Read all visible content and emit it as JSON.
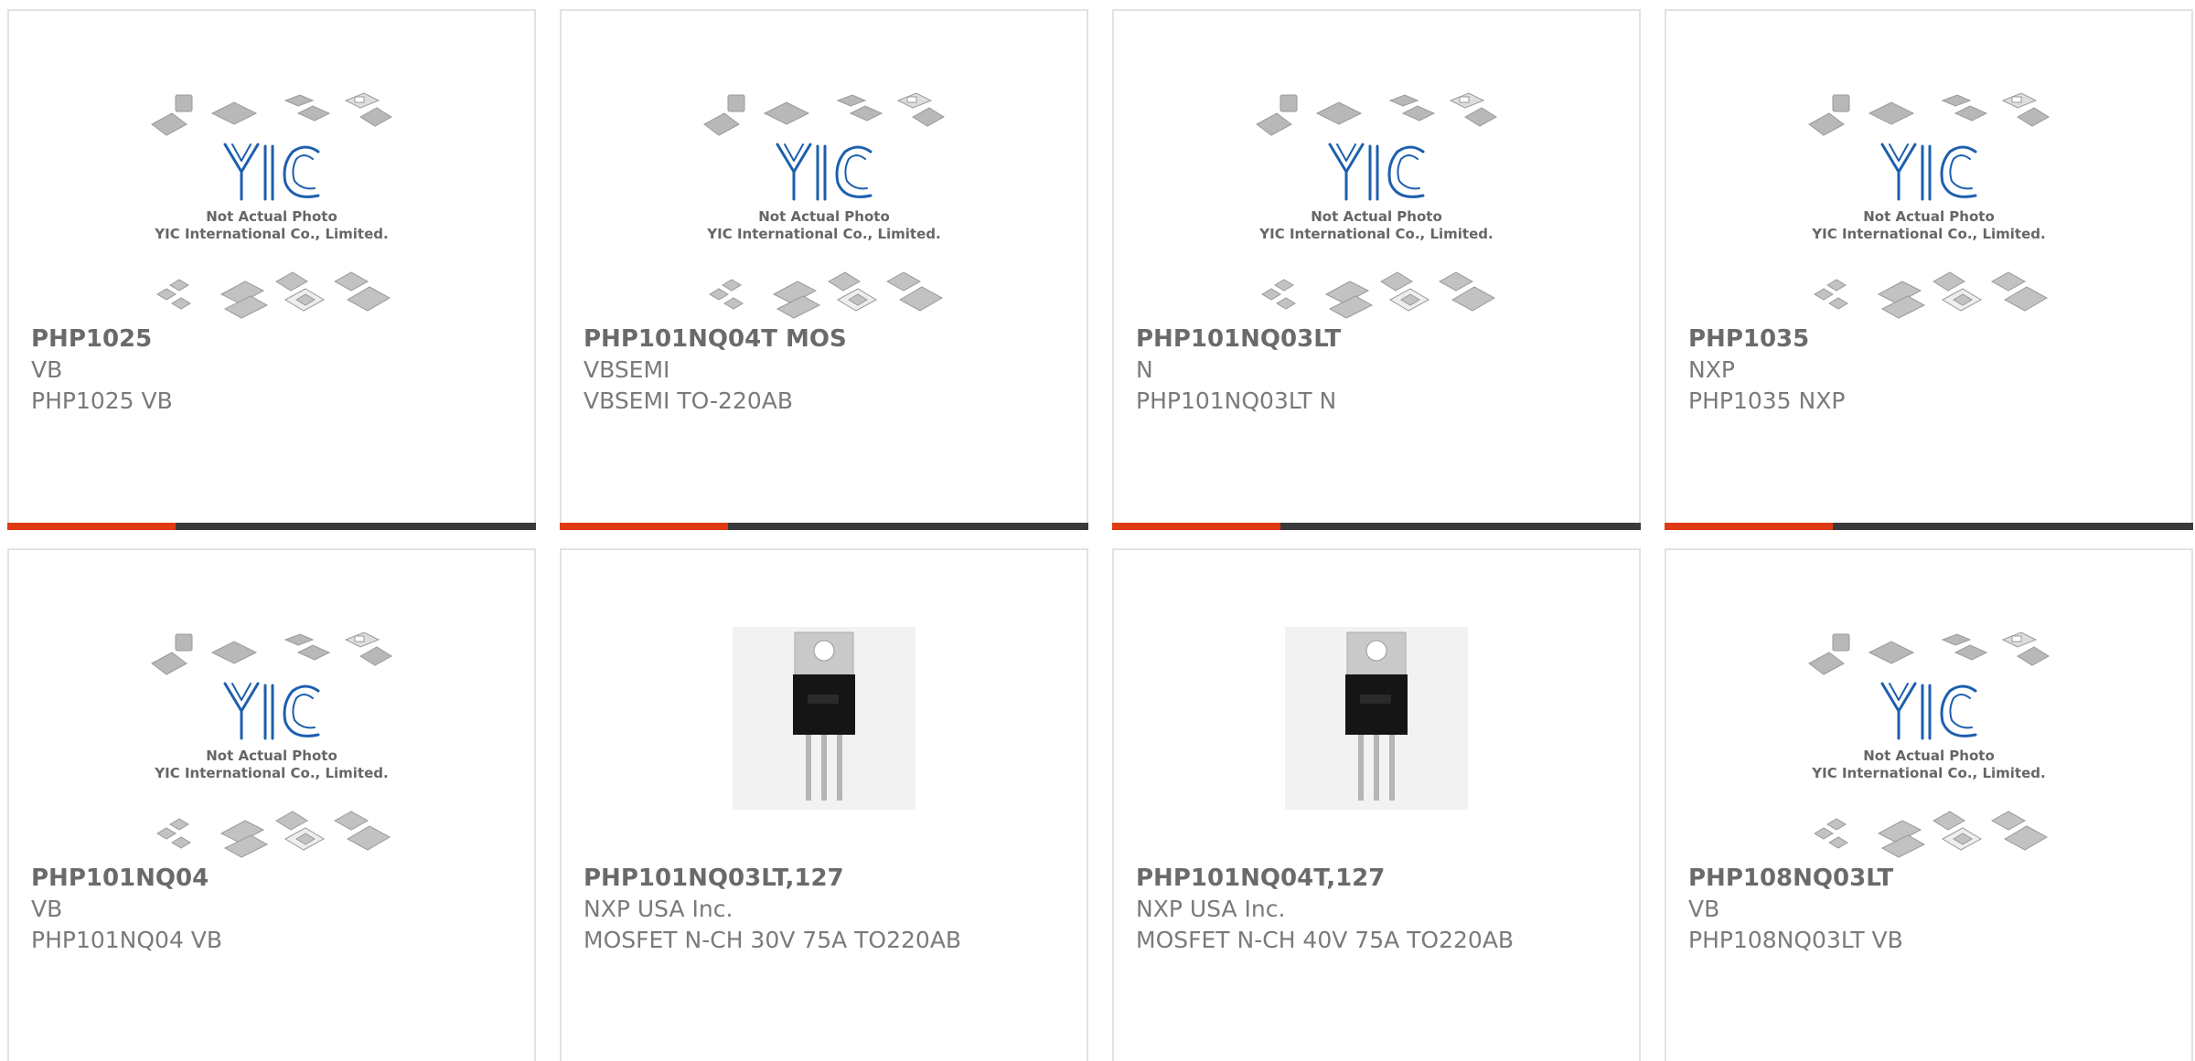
{
  "products": [
    {
      "part_number": "PHP1025",
      "manufacturer": "VB",
      "description": "PHP1025 VB",
      "image": "placeholder",
      "placeholder_line1": "Not Actual Photo",
      "placeholder_line2": "YIC International Co., Limited."
    },
    {
      "part_number": "PHP101NQ04T MOS",
      "manufacturer": "VBSEMI",
      "description": "VBSEMI TO-220AB",
      "image": "placeholder",
      "placeholder_line1": "Not Actual Photo",
      "placeholder_line2": "YIC International Co., Limited."
    },
    {
      "part_number": "PHP101NQ03LT",
      "manufacturer": "N",
      "description": "PHP101NQ03LT N",
      "image": "placeholder",
      "placeholder_line1": "Not Actual Photo",
      "placeholder_line2": "YIC International Co., Limited."
    },
    {
      "part_number": "PHP1035",
      "manufacturer": "NXP",
      "description": "PHP1035 NXP",
      "image": "placeholder",
      "placeholder_line1": "Not Actual Photo",
      "placeholder_line2": "YIC International Co., Limited."
    },
    {
      "part_number": "PHP101NQ04",
      "manufacturer": "VB",
      "description": "PHP101NQ04 VB",
      "image": "placeholder",
      "placeholder_line1": "Not Actual Photo",
      "placeholder_line2": "YIC International Co., Limited."
    },
    {
      "part_number": "PHP101NQ03LT,127",
      "manufacturer": "NXP USA Inc.",
      "description": "MOSFET N-CH 30V 75A TO220AB",
      "image": "to220-photo"
    },
    {
      "part_number": "PHP101NQ04T,127",
      "manufacturer": "NXP USA Inc.",
      "description": "MOSFET N-CH 40V 75A TO220AB",
      "image": "to220-photo"
    },
    {
      "part_number": "PHP108NQ03LT",
      "manufacturer": "VB",
      "description": "PHP108NQ03LT VB",
      "image": "placeholder",
      "placeholder_line1": "Not Actual Photo",
      "placeholder_line2": "YIC International Co., Limited."
    }
  ],
  "logo_text": "YIC",
  "colors": {
    "accent": "#e03a14",
    "bar": "#3a3a3a",
    "logo_blue": "#1d5fae",
    "text": "#6a6a6a"
  }
}
